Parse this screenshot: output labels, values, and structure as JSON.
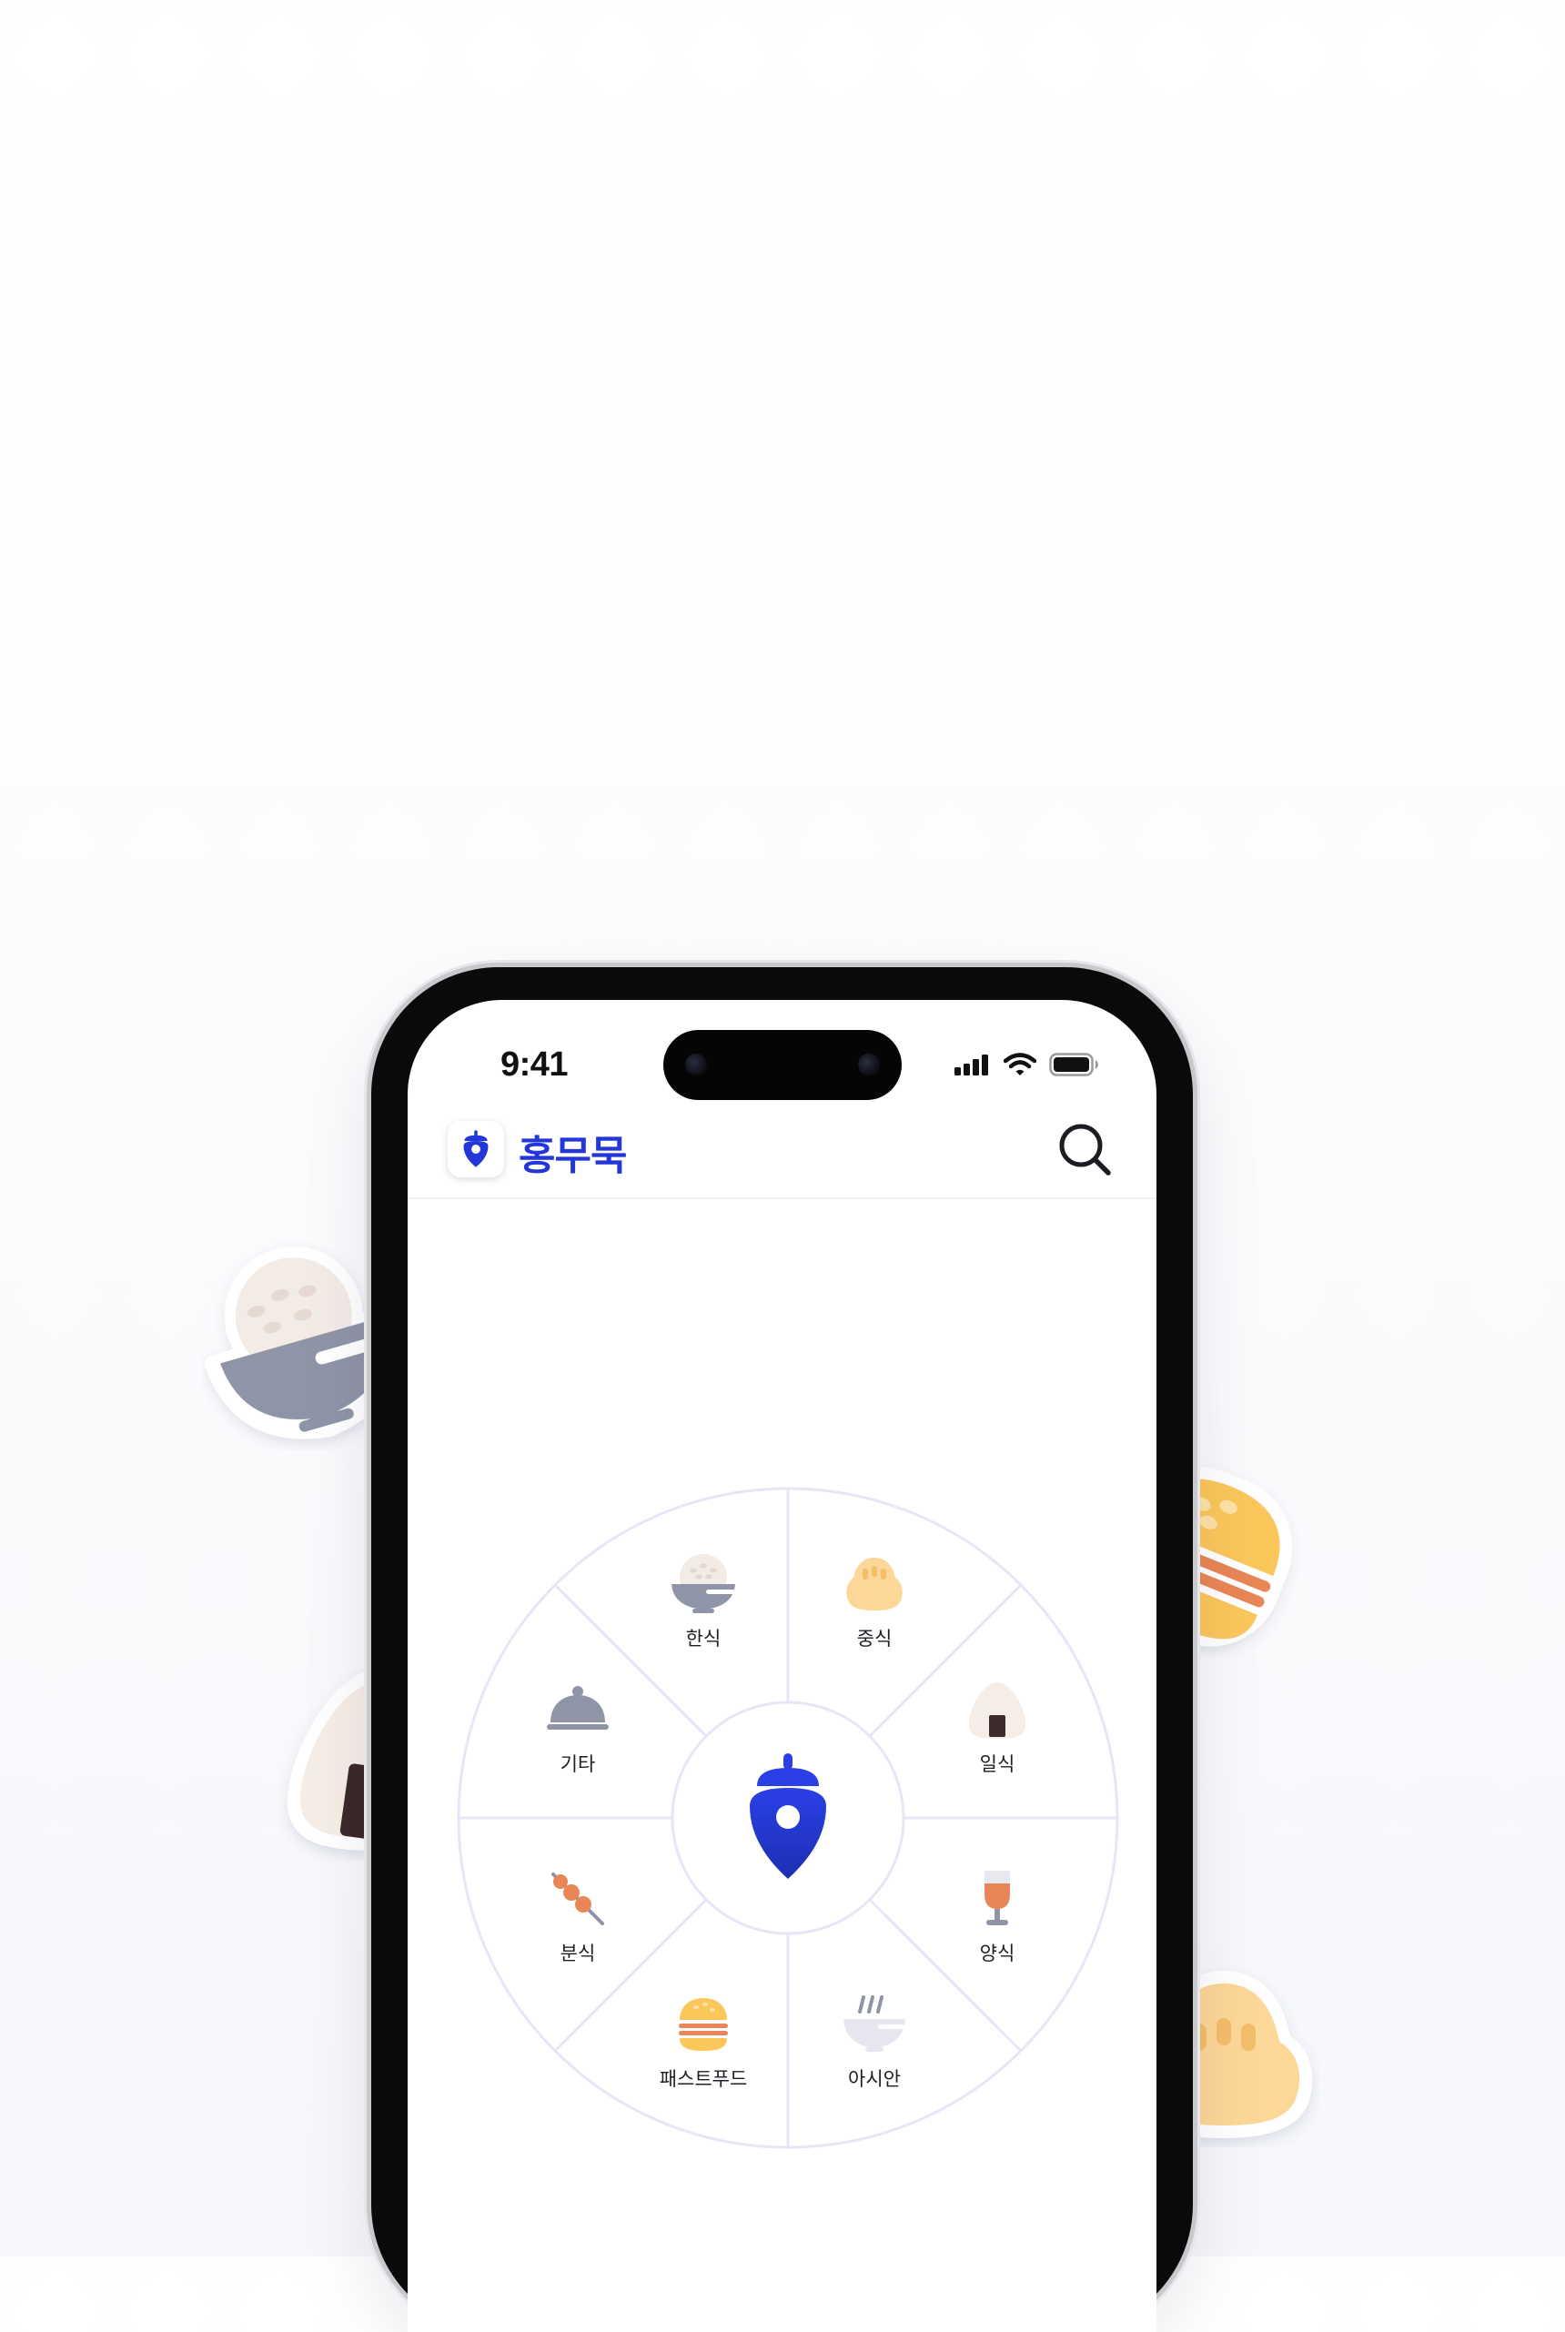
{
  "status_bar": {
    "time": "9:41",
    "icons": [
      "cellular-signal-icon",
      "wifi-icon",
      "battery-icon"
    ]
  },
  "header": {
    "app_name": "홍무묵",
    "logo_icon": "acorn-location-pin-icon",
    "search_icon": "search-icon"
  },
  "wheel": {
    "center_icon": "acorn-location-pin-icon",
    "categories": [
      {
        "label": "한식",
        "icon": "rice-bowl-icon"
      },
      {
        "label": "중식",
        "icon": "dumpling-icon"
      },
      {
        "label": "일식",
        "icon": "onigiri-icon"
      },
      {
        "label": "양식",
        "icon": "wine-glass-icon"
      },
      {
        "label": "아시안",
        "icon": "noodle-bowl-icon"
      },
      {
        "label": "패스트푸드",
        "icon": "burger-icon"
      },
      {
        "label": "분식",
        "icon": "skewer-icon"
      },
      {
        "label": "기타",
        "icon": "cloche-icon"
      }
    ]
  },
  "decorations": [
    "rice-bowl-sticker",
    "onigiri-sticker",
    "burger-sticker",
    "dumpling-sticker"
  ],
  "colors": {
    "brand_blue": "#2336d8",
    "wheel_line": "#e8e6f6",
    "food_gray": "#8f96a8",
    "food_yellow": "#fbc65a",
    "food_orange": "#e98657",
    "rice_cream": "#f6ede6",
    "seaweed": "#3b2b2b",
    "dumpling": "#fdd797"
  }
}
